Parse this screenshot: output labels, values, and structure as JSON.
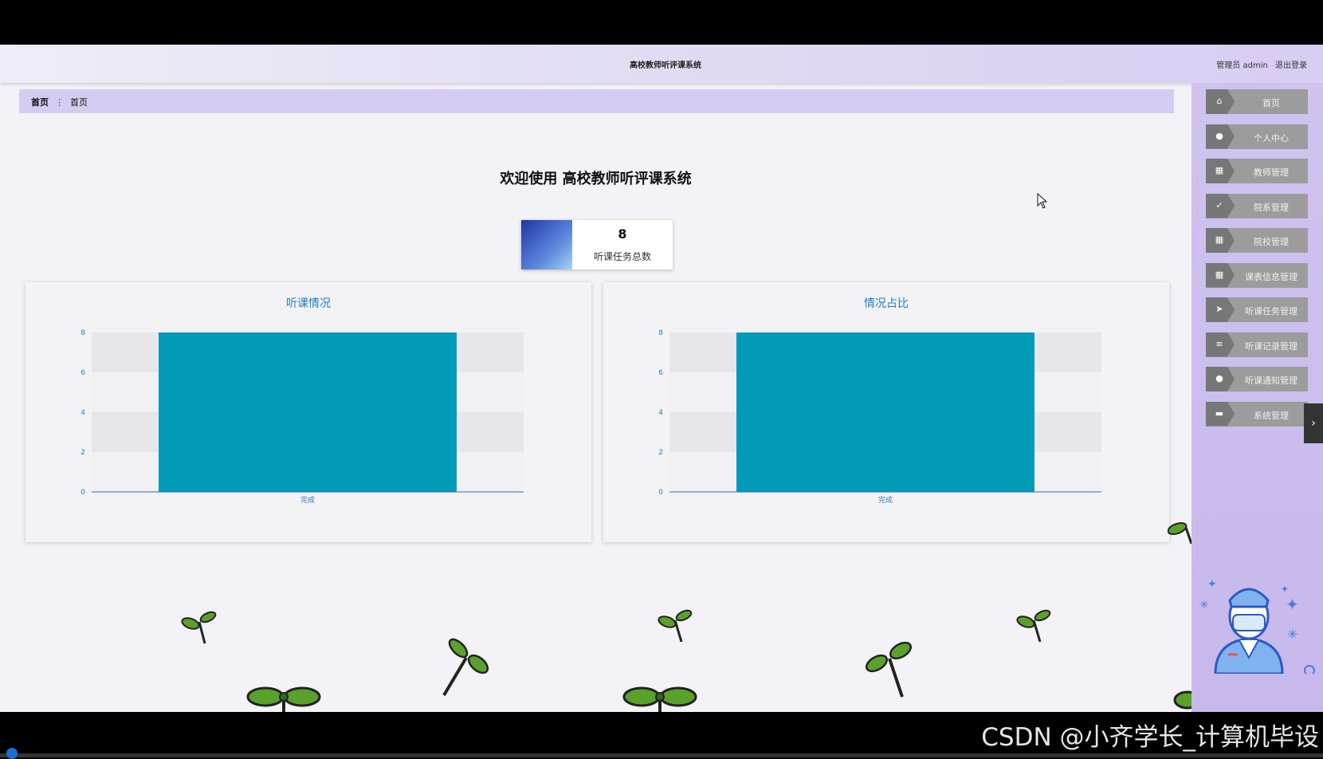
{
  "header": {
    "title": "高校教师听评课系统",
    "user_label": "管理员 admin",
    "logout_label": "退出登录"
  },
  "breadcrumb": {
    "root": "首页",
    "separator": "⋮",
    "current": "首页"
  },
  "welcome": "欢迎使用 高校教师听评课系统",
  "stat": {
    "value": "8",
    "label": "听课任务总数"
  },
  "charts": [
    {
      "title": "听课情况"
    },
    {
      "title": "情况占比"
    }
  ],
  "chart_data": [
    {
      "type": "bar",
      "title": "听课情况",
      "categories": [
        "完成"
      ],
      "values": [
        8
      ],
      "ylim": [
        0,
        8
      ],
      "yticks": [
        "0",
        "2",
        "4",
        "6",
        "8"
      ],
      "color": "#019bb8"
    },
    {
      "type": "bar",
      "title": "情况占比",
      "categories": [
        "完成"
      ],
      "values": [
        8
      ],
      "ylim": [
        0,
        8
      ],
      "yticks": [
        "0",
        "2",
        "4",
        "6",
        "8"
      ],
      "color": "#019bb8"
    }
  ],
  "sidebar": {
    "items": [
      {
        "label": "首页",
        "icon": "home-icon"
      },
      {
        "label": "个人中心",
        "icon": "user-icon"
      },
      {
        "label": "教师管理",
        "icon": "grid-icon"
      },
      {
        "label": "院系管理",
        "icon": "check-icon"
      },
      {
        "label": "院校管理",
        "icon": "grid-icon"
      },
      {
        "label": "课表信息管理",
        "icon": "grid-icon"
      },
      {
        "label": "听课任务管理",
        "icon": "send-icon"
      },
      {
        "label": "听课记录管理",
        "icon": "list-icon"
      },
      {
        "label": "听课通知管理",
        "icon": "user-icon"
      },
      {
        "label": "系统管理",
        "icon": "chat-icon"
      }
    ]
  },
  "watermark": "CSDN @小齐学长_计算机毕设"
}
